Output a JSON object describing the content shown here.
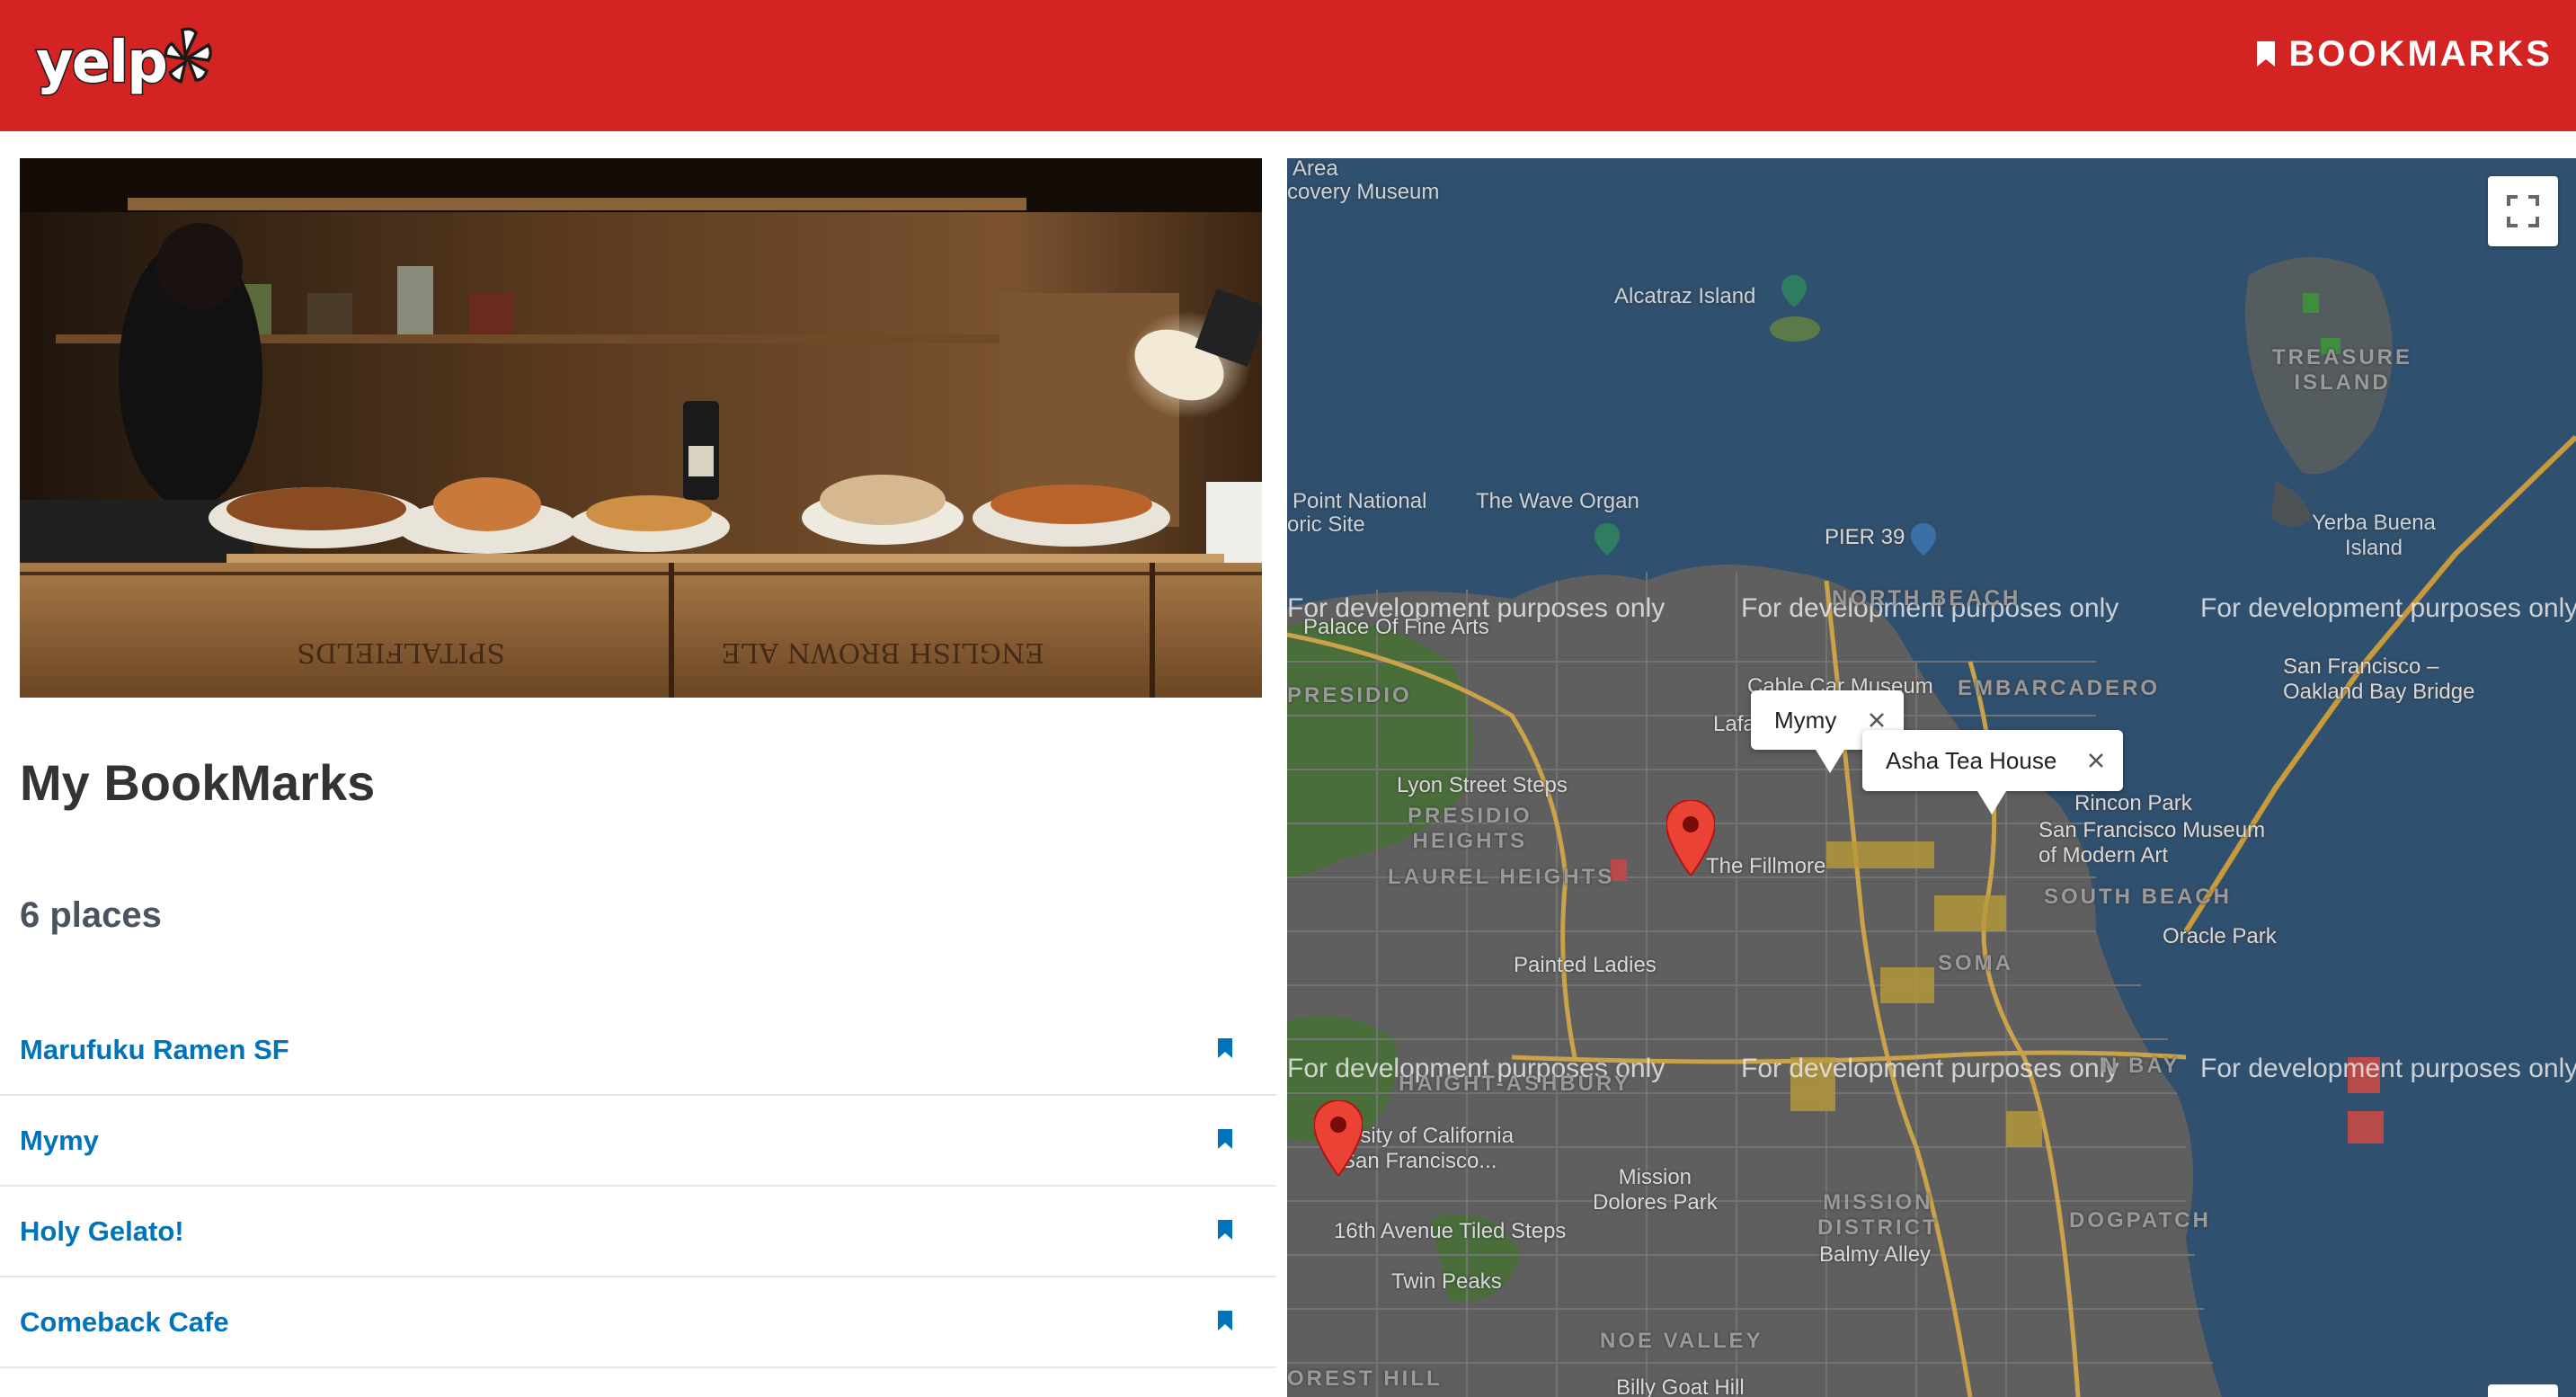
{
  "header": {
    "logo_text": "yelp",
    "bookmarks_label": "BOOKMARKS",
    "background_color": "#d32323"
  },
  "main": {
    "title": "My BookMarks",
    "place_count": "6 places",
    "places": [
      {
        "name": "Marufuku Ramen SF"
      },
      {
        "name": "Mymy"
      },
      {
        "name": "Holy Gelato!"
      },
      {
        "name": "Comeback Cafe"
      }
    ],
    "link_color": "#0073bb"
  },
  "map": {
    "watermark": "For development purposes only",
    "labels": {
      "area": "Area",
      "discovery_museum": "covery Museum",
      "alcatraz": "Alcatraz Island",
      "treasure_island": "TREASURE\nISLAND",
      "point_national": "Point National",
      "oric_site": "oric Site",
      "wave_organ": "The Wave Organ",
      "pier39": "PIER 39",
      "yerba_buena": "Yerba Buena\nIsland",
      "north_beach": "NORTH BEACH",
      "palace": "Palace Of Fine Arts",
      "sf_bridge": "San Francisco –\nOakland Bay Bridge",
      "presidio": "PRESIDIO",
      "cable_car": "Cable Car Museum",
      "embarcadero": "EMBARCADERO",
      "lafayette": "Lafayett",
      "lyon_steps": "Lyon Street Steps",
      "presidio_heights": "PRESIDIO\nHEIGHTS",
      "rincon_park": "Rincon Park",
      "sfmoma": "San Francisco Museum\nof Modern Art",
      "the_fillmore": "The Fillmore",
      "laurel_heights": "LAUREL HEIGHTS",
      "south_beach": "SOUTH BEACH",
      "oracle_park": "Oracle Park",
      "soma": "SOMA",
      "painted_ladies": "Painted Ladies",
      "haight": "HAIGHT-ASHBURY",
      "ucsf": "ersity of California\nSan Francisco...",
      "mission_dolores": "Mission\nDolores Park",
      "mission_district": "MISSION\nDISTRICT",
      "dogpatch": "DOGPATCH",
      "tiled_steps": "16th Avenue Tiled Steps",
      "balmy_alley": "Balmy Alley",
      "twin_peaks": "Twin Peaks",
      "noe_valley": "NOE VALLEY",
      "forest_hill": "OREST HILL",
      "billy_goat": "Billy Goat Hill",
      "bay_partial": "N BAY"
    },
    "infowindows": [
      {
        "text": "Mymy"
      },
      {
        "text": "Asha Tea House"
      }
    ],
    "marker_color": "#ea4335"
  }
}
